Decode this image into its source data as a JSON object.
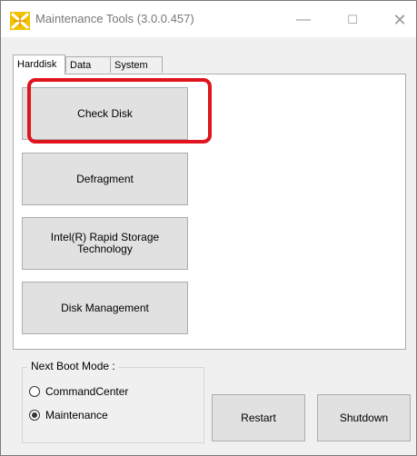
{
  "window": {
    "title": "Maintenance Tools (3.0.0.457)",
    "controls": {
      "minimize": "—",
      "maximize": "☐",
      "close": "✕"
    }
  },
  "tabs": [
    {
      "label": "Harddisk",
      "active": true
    },
    {
      "label": "Data",
      "active": false
    },
    {
      "label": "System",
      "active": false
    }
  ],
  "harddisk": {
    "check_disk": "Check Disk",
    "defragment": "Defragment",
    "rst_line1": "Intel(R) Rapid Storage",
    "rst_line2": "Technology",
    "disk_management": "Disk Management"
  },
  "boot_mode": {
    "title": "Next Boot Mode :",
    "options": [
      {
        "label": "CommandCenter",
        "selected": false
      },
      {
        "label": "Maintenance",
        "selected": true
      }
    ]
  },
  "actions": {
    "restart": "Restart",
    "shutdown": "Shutdown"
  },
  "colors": {
    "highlight": "#e0141e",
    "icon_yellow": "#f2c200",
    "button_bg": "#e1e1e1"
  },
  "icons": {
    "app": "tools-icon"
  }
}
